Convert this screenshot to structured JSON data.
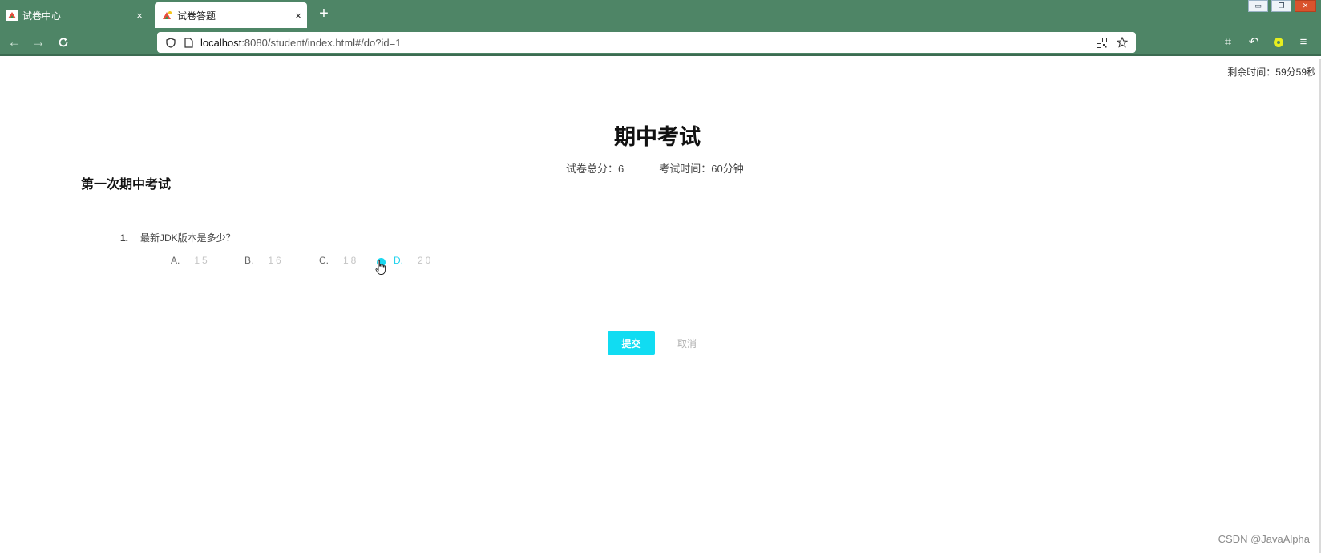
{
  "browser": {
    "tabs": [
      {
        "title": "试卷中心",
        "close": "×"
      },
      {
        "title": "试卷答题",
        "close": "×"
      }
    ],
    "new_tab": "+",
    "url_host": "localhost",
    "url_rest": ":8080/student/index.html#/do?id=1",
    "colors": {
      "chrome": "#4e8566",
      "accent": "#11dcf2"
    }
  },
  "page": {
    "timer": "剩余时间：59分59秒",
    "exam_title": "期中考试",
    "total_score": "试卷总分：6",
    "duration": "考试时间：60分钟",
    "paper_title": "第一次期中考试",
    "questions": [
      {
        "number": "1.",
        "text": "最新JDK版本是多少？",
        "options": [
          {
            "letter": "A.",
            "value": "15"
          },
          {
            "letter": "B.",
            "value": "16"
          },
          {
            "letter": "C.",
            "value": "18"
          },
          {
            "letter": "D.",
            "value": "20"
          }
        ],
        "selected": "D."
      }
    ],
    "submit_label": "提交",
    "cancel_label": "取消",
    "watermark": "CSDN @JavaAlpha"
  }
}
